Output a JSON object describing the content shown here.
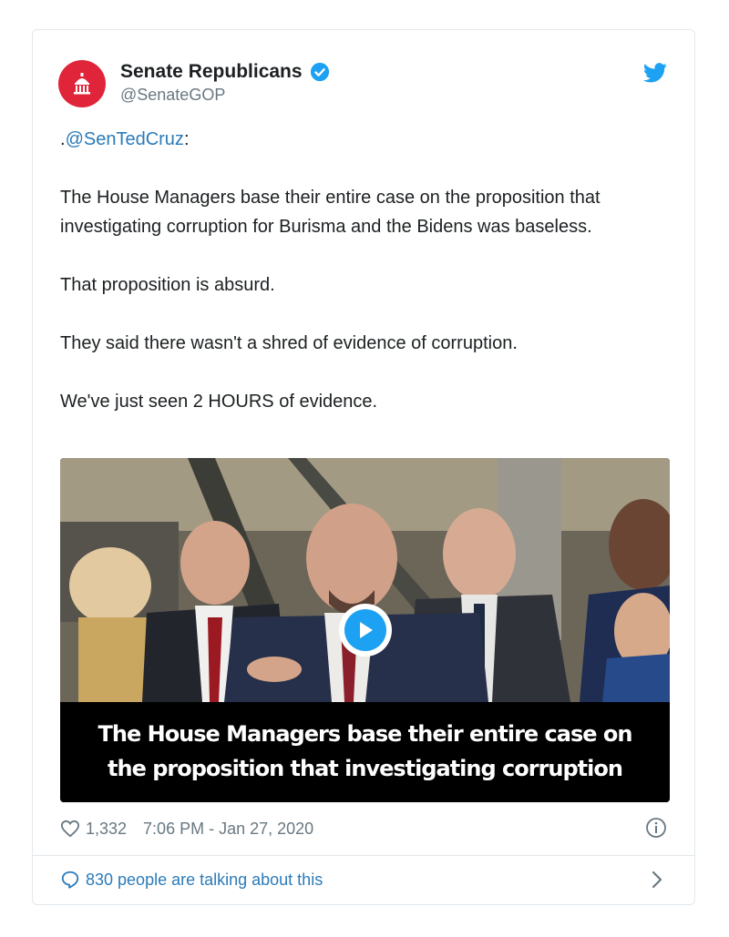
{
  "account": {
    "display_name": "Senate Republicans",
    "handle": "@SenateGOP",
    "verified": true,
    "avatar_color": "#e0253a"
  },
  "tweet": {
    "mention_prefix": ".",
    "mention": "@SenTedCruz",
    "mention_suffix": ":",
    "paragraphs": [
      "The House Managers base their entire case on the proposition that investigating corruption for Burisma and the Bidens was baseless.",
      "That proposition is absurd.",
      "They said there wasn't a shred of evidence of corruption.",
      "We've just seen 2 HOURS of evidence."
    ]
  },
  "media": {
    "caption_line1": "The House Managers base their entire case on",
    "caption_line2": "the proposition that investigating corruption",
    "play_icon": "play-icon"
  },
  "meta": {
    "like_count": "1,332",
    "timestamp": "7:06 PM - Jan 27, 2020"
  },
  "footer": {
    "talking_label": "830 people are talking about this"
  },
  "colors": {
    "link": "#2b7bb9",
    "twitter_blue": "#1da1f2",
    "muted": "#697882",
    "border": "#e1e8ed"
  }
}
